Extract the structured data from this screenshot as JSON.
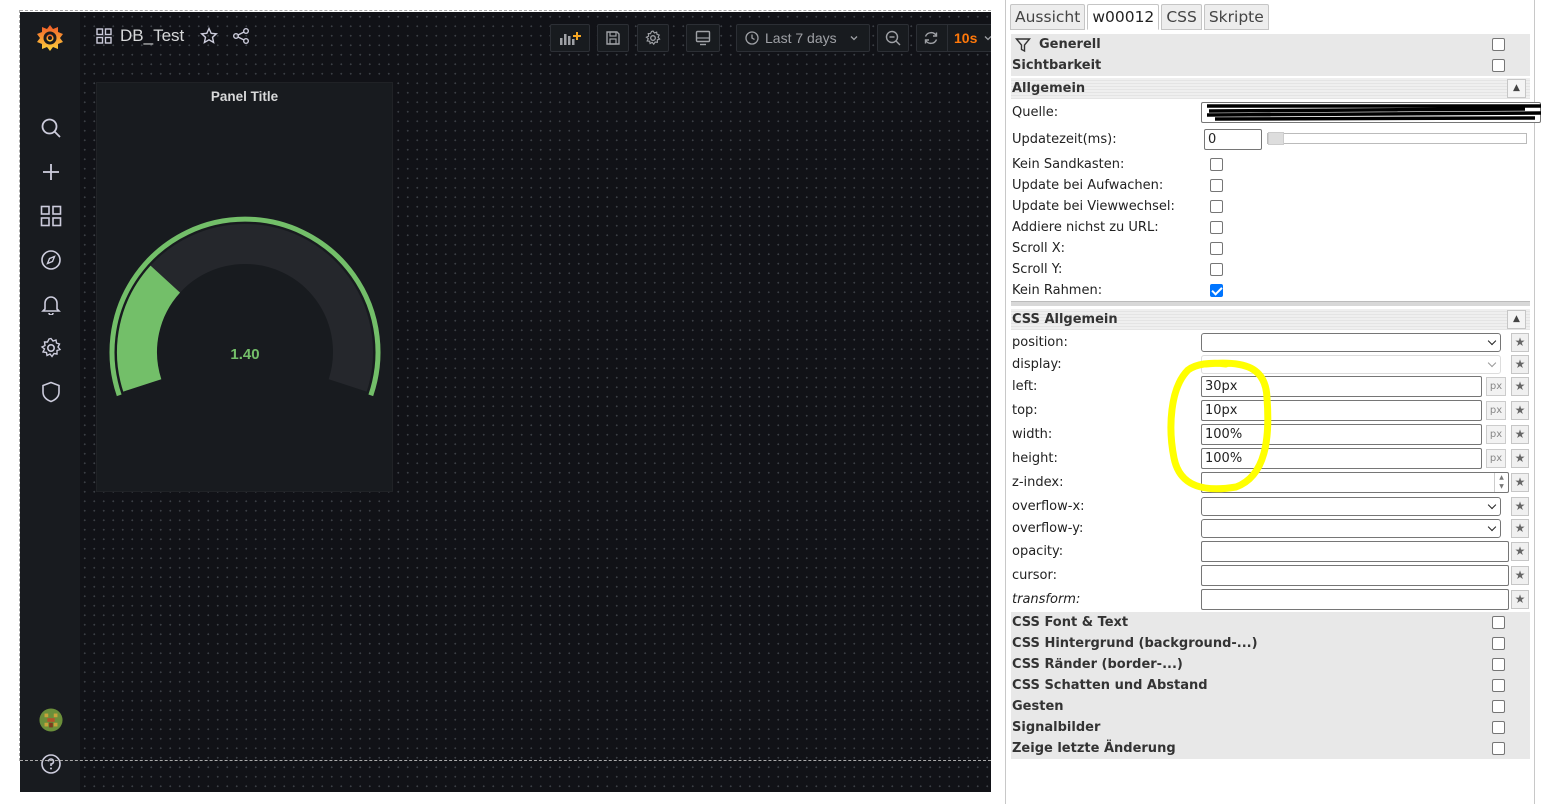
{
  "grafana": {
    "dashboard_title": "DB_Test",
    "time_range": "Last 7 days",
    "refresh": "10s",
    "panel": {
      "title": "Panel Title",
      "value": "1.40",
      "gauge_fraction": 0.28
    },
    "colors": {
      "accent": "#73bf69",
      "refresh": "#ff780a",
      "background": "#111217"
    }
  },
  "editor": {
    "tabs": [
      "Aussicht",
      "w00012",
      "CSS",
      "Skripte"
    ],
    "active_tab": "w00012",
    "sections_top": [
      {
        "label": "Generell",
        "checked": false
      },
      {
        "label": "Sichtbarkeit",
        "checked": false
      }
    ],
    "allgemein": {
      "title": "Allgemein",
      "quelle_label": "Quelle:",
      "updatezeit_label": "Updatezeit(ms):",
      "updatezeit_value": "0",
      "checks": [
        {
          "label": "Kein Sandkasten:",
          "checked": false
        },
        {
          "label": "Update bei Aufwachen:",
          "checked": false
        },
        {
          "label": "Update bei Viewwechsel:",
          "checked": false
        },
        {
          "label": "Addiere nichst zu URL:",
          "checked": false
        },
        {
          "label": "Scroll X:",
          "checked": false
        },
        {
          "label": "Scroll Y:",
          "checked": false
        },
        {
          "label": "Kein Rahmen:",
          "checked": true
        }
      ]
    },
    "css_allgemein": {
      "title": "CSS Allgemein",
      "position_label": "position:",
      "display_label": "display:",
      "left_label": "left:",
      "left_value": "30px",
      "top_label": "top:",
      "top_value": "10px",
      "width_label": "width:",
      "width_value": "100%",
      "height_label": "height:",
      "height_value": "100%",
      "zindex_label": "z-index:",
      "overflowx_label": "overflow-x:",
      "overflowy_label": "overflow-y:",
      "opacity_label": "opacity:",
      "cursor_label": "cursor:",
      "transform_label": "transform:",
      "unit": "px"
    },
    "sections_bottom": [
      "CSS Font & Text",
      "CSS Hintergrund (background-...)",
      "CSS Ränder (border-...)",
      "CSS Schatten und Abstand",
      "Gesten",
      "Signalbilder",
      "Zeige letzte Änderung"
    ],
    "highlight_color": "#ffff00"
  }
}
